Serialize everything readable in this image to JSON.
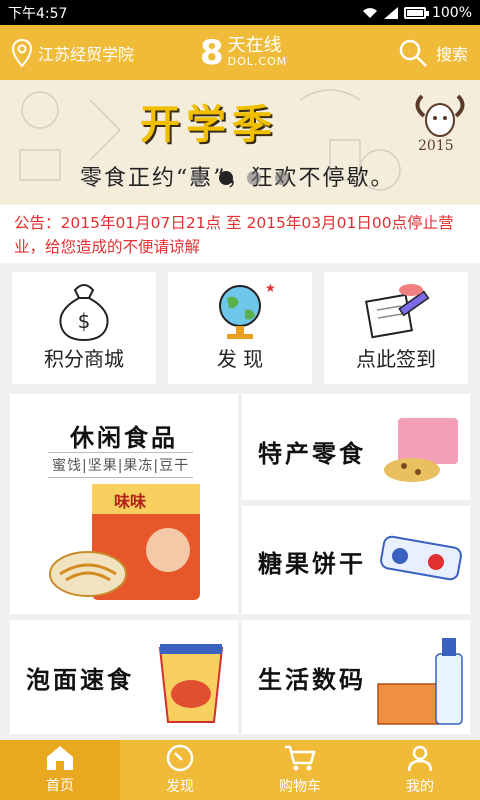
{
  "status": {
    "time": "下午4:57",
    "battery": "100%",
    "battery_level": 1.0
  },
  "header": {
    "location": "江苏经贸学院",
    "logo_number": "8",
    "logo_name": "天在线",
    "logo_domain": "DOL.COM",
    "search_label": "搜索"
  },
  "banner": {
    "title": "开学季",
    "subtitle": "零食正约“惠”，狂欢不停歇。",
    "badge_year": "2015",
    "slides_total": 4,
    "slide_active": 2
  },
  "notice": {
    "text": "公告：2015年01月07日21点 至 2015年03月01日00点停止营业，给您造成的不便请谅解"
  },
  "features": [
    {
      "label": "积分商城",
      "icon": "money-bag-icon"
    },
    {
      "label": "发 现",
      "icon": "globe-icon"
    },
    {
      "label": "点此签到",
      "icon": "sign-in-icon"
    }
  ],
  "categories": {
    "snacks": {
      "title": "休闲食品",
      "sub": "蜜饯|坚果|果冻|豆干",
      "pack_text": "味味"
    },
    "specialty": {
      "title": "特产零食"
    },
    "candy": {
      "title": "糖果饼干"
    },
    "noodles": {
      "title": "泡面速食"
    },
    "digital": {
      "title": "生活数码"
    }
  },
  "nav": {
    "items": [
      {
        "label": "首页",
        "icon": "home-icon",
        "active": true
      },
      {
        "label": "发现",
        "icon": "compass-icon",
        "active": false
      },
      {
        "label": "购物车",
        "icon": "cart-icon",
        "active": false
      },
      {
        "label": "我的",
        "icon": "user-icon",
        "active": false
      }
    ]
  },
  "colors": {
    "primary": "#f0bb38",
    "notice": "#e23030"
  }
}
